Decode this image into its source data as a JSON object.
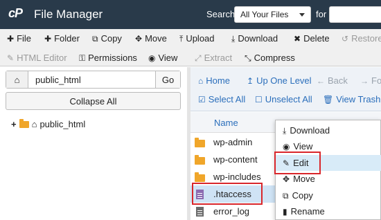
{
  "header": {
    "logo": "cP",
    "title": "File Manager",
    "search_label": "Search",
    "search_scope": "All Your Files",
    "for_label": "for",
    "search_value": ""
  },
  "toolbar1": {
    "file": "File",
    "folder": "Folder",
    "copy": "Copy",
    "move": "Move",
    "upload": "Upload",
    "download": "Download",
    "delete": "Delete",
    "restore": "Restore"
  },
  "toolbar2": {
    "html_editor": "HTML Editor",
    "permissions": "Permissions",
    "view": "View",
    "extract": "Extract",
    "compress": "Compress"
  },
  "left": {
    "path_value": "public_html",
    "go": "Go",
    "collapse_all": "Collapse All",
    "tree_root": "public_html"
  },
  "nav": {
    "home": "Home",
    "up_one_level": "Up One Level",
    "back": "Back",
    "forward": "For",
    "select_all": "Select All",
    "unselect_all": "Unselect All",
    "view_trash": "View Trash"
  },
  "list": {
    "col_name": "Name",
    "rows": [
      {
        "name": "wp-admin",
        "type": "folder"
      },
      {
        "name": "wp-content",
        "type": "folder"
      },
      {
        "name": "wp-includes",
        "type": "folder"
      },
      {
        "name": ".htaccess",
        "type": "file",
        "selected": true
      },
      {
        "name": "error_log",
        "type": "file"
      }
    ]
  },
  "context_menu": {
    "items": [
      "Download",
      "View",
      "Edit",
      "Move",
      "Copy",
      "Rename"
    ],
    "highlighted": "Edit"
  },
  "colors": {
    "header_bg": "#293a4a",
    "link_blue": "#2a6ebb",
    "folder": "#f0a62a",
    "highlight_red": "#d9262b",
    "selection": "#cfe3f5"
  }
}
